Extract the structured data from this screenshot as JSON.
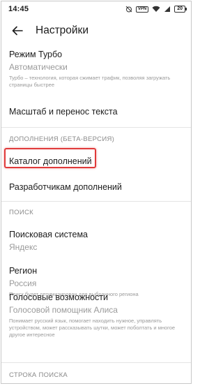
{
  "status_bar": {
    "time": "14:45",
    "icons": [
      "alarm-off-icon",
      "vpn-icon",
      "wifi-icon",
      "signal-icon",
      "battery-icon"
    ],
    "vpn_label": "VPN",
    "battery_level": "20"
  },
  "header": {
    "back_icon": "arrow-left-icon",
    "title": "Настройки"
  },
  "settings": {
    "turbo": {
      "title": "Режим Турбо",
      "value": "Автоматически",
      "description": "Турбо – технология, которая сжимает трафик, позволяя загружать страницы быстрее"
    },
    "scale": {
      "title": "Масштаб и перенос текста"
    },
    "addons_section": "ДОПОЛНЕНИЯ (БЕТА-ВЕРСИЯ)",
    "addons_catalog": {
      "title": "Каталог дополнений"
    },
    "addons_developers": {
      "title": "Разработчикам дополнений"
    },
    "search_section": "ПОИСК",
    "search_engine": {
      "title": "Поисковая система",
      "value": "Яндекс"
    },
    "region": {
      "title": "Регион",
      "value": "Россия",
      "description": "Поиск будет оптимизирован для выбранного региона"
    },
    "voice": {
      "title": "Голосовые возможности",
      "value": "Голосовой помощник Алиса",
      "description": "Понимает русский язык, помогает находить нужное, управлять устройством, может рассказывать шутки, может поболтать и многое другое интересное"
    },
    "search_bar_section": "СТРОКА ПОИСКА"
  },
  "colors": {
    "highlight": "#e03a3a",
    "secondary_text": "#9a9a9a",
    "divider": "#e4e4e4"
  }
}
